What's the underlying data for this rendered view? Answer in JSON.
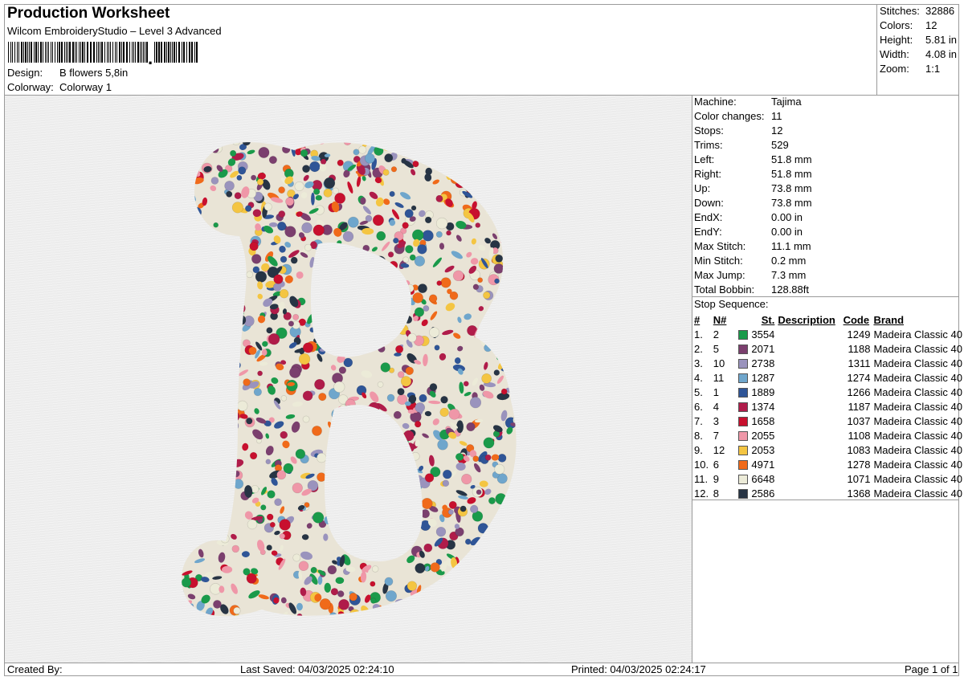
{
  "header": {
    "title": "Production Worksheet",
    "software": "Wilcom EmbroideryStudio – Level 3 Advanced",
    "design_label": "Design:",
    "design_value": "B flowers 5,8in",
    "colorway_label": "Colorway:",
    "colorway_value": "Colorway 1"
  },
  "summary": [
    {
      "label": "Stitches:",
      "value": "32886"
    },
    {
      "label": "Colors:",
      "value": "12"
    },
    {
      "label": "Height:",
      "value": "5.81 in"
    },
    {
      "label": "Width:",
      "value": "4.08 in"
    },
    {
      "label": "Zoom:",
      "value": "1:1"
    }
  ],
  "machine_info": [
    {
      "label": "Machine:",
      "value": "Tajima"
    },
    {
      "label": "Color changes:",
      "value": "11"
    },
    {
      "label": "Stops:",
      "value": "12"
    },
    {
      "label": "Trims:",
      "value": "529"
    },
    {
      "label": "Left:",
      "value": "51.8 mm"
    },
    {
      "label": "Right:",
      "value": "51.8 mm"
    },
    {
      "label": "Up:",
      "value": "73.8 mm"
    },
    {
      "label": "Down:",
      "value": "73.8 mm"
    },
    {
      "label": "EndX:",
      "value": "0.00 in"
    },
    {
      "label": "EndY:",
      "value": "0.00 in"
    },
    {
      "label": "Max Stitch:",
      "value": "11.1 mm"
    },
    {
      "label": "Min Stitch:",
      "value": "0.2 mm"
    },
    {
      "label": "Max Jump:",
      "value": "7.3 mm"
    },
    {
      "label": "Total Bobbin:",
      "value": "128.88ft"
    }
  ],
  "stop_sequence": {
    "title": "Stop Sequence:",
    "headers": [
      "#",
      "N#",
      "St.",
      "Description",
      "Code",
      "Brand"
    ],
    "rows": [
      {
        "idx": "1.",
        "n": "2",
        "color": "#1a9a4a",
        "st": "3554",
        "desc": "",
        "code": "1249",
        "brand": "Madeira Classic 40"
      },
      {
        "idx": "2.",
        "n": "5",
        "color": "#7b3f6e",
        "st": "2071",
        "desc": "",
        "code": "1188",
        "brand": "Madeira Classic 40"
      },
      {
        "idx": "3.",
        "n": "10",
        "color": "#9a93bd",
        "st": "2738",
        "desc": "",
        "code": "1311",
        "brand": "Madeira Classic 40"
      },
      {
        "idx": "4.",
        "n": "11",
        "color": "#6fa6cc",
        "st": "1287",
        "desc": "",
        "code": "1274",
        "brand": "Madeira Classic 40"
      },
      {
        "idx": "5.",
        "n": "1",
        "color": "#2f5597",
        "st": "1889",
        "desc": "",
        "code": "1266",
        "brand": "Madeira Classic 40"
      },
      {
        "idx": "6.",
        "n": "4",
        "color": "#b01c4a",
        "st": "1374",
        "desc": "",
        "code": "1187",
        "brand": "Madeira Classic 40"
      },
      {
        "idx": "7.",
        "n": "3",
        "color": "#c8102e",
        "st": "1658",
        "desc": "",
        "code": "1037",
        "brand": "Madeira Classic 40"
      },
      {
        "idx": "8.",
        "n": "7",
        "color": "#ef97a8",
        "st": "2055",
        "desc": "",
        "code": "1108",
        "brand": "Madeira Classic 40"
      },
      {
        "idx": "9.",
        "n": "12",
        "color": "#f4c542",
        "st": "2053",
        "desc": "",
        "code": "1083",
        "brand": "Madeira Classic 40"
      },
      {
        "idx": "10.",
        "n": "6",
        "color": "#f06a1a",
        "st": "4971",
        "desc": "",
        "code": "1278",
        "brand": "Madeira Classic 40"
      },
      {
        "idx": "11.",
        "n": "9",
        "color": "#ecebd8",
        "st": "6648",
        "desc": "",
        "code": "1071",
        "brand": "Madeira Classic 40"
      },
      {
        "idx": "12.",
        "n": "8",
        "color": "#273444",
        "st": "2586",
        "desc": "",
        "code": "1368",
        "brand": "Madeira Classic 40"
      }
    ]
  },
  "footer": {
    "created_by": "Created By:",
    "last_saved": "Last Saved: 04/03/2025 02:24:10",
    "printed": "Printed: 04/03/2025 02:24:17",
    "page": "Page 1 of 1"
  },
  "preview": {
    "icon": "embroidered-floral-letter-b-image",
    "background_color": "#ececec"
  }
}
